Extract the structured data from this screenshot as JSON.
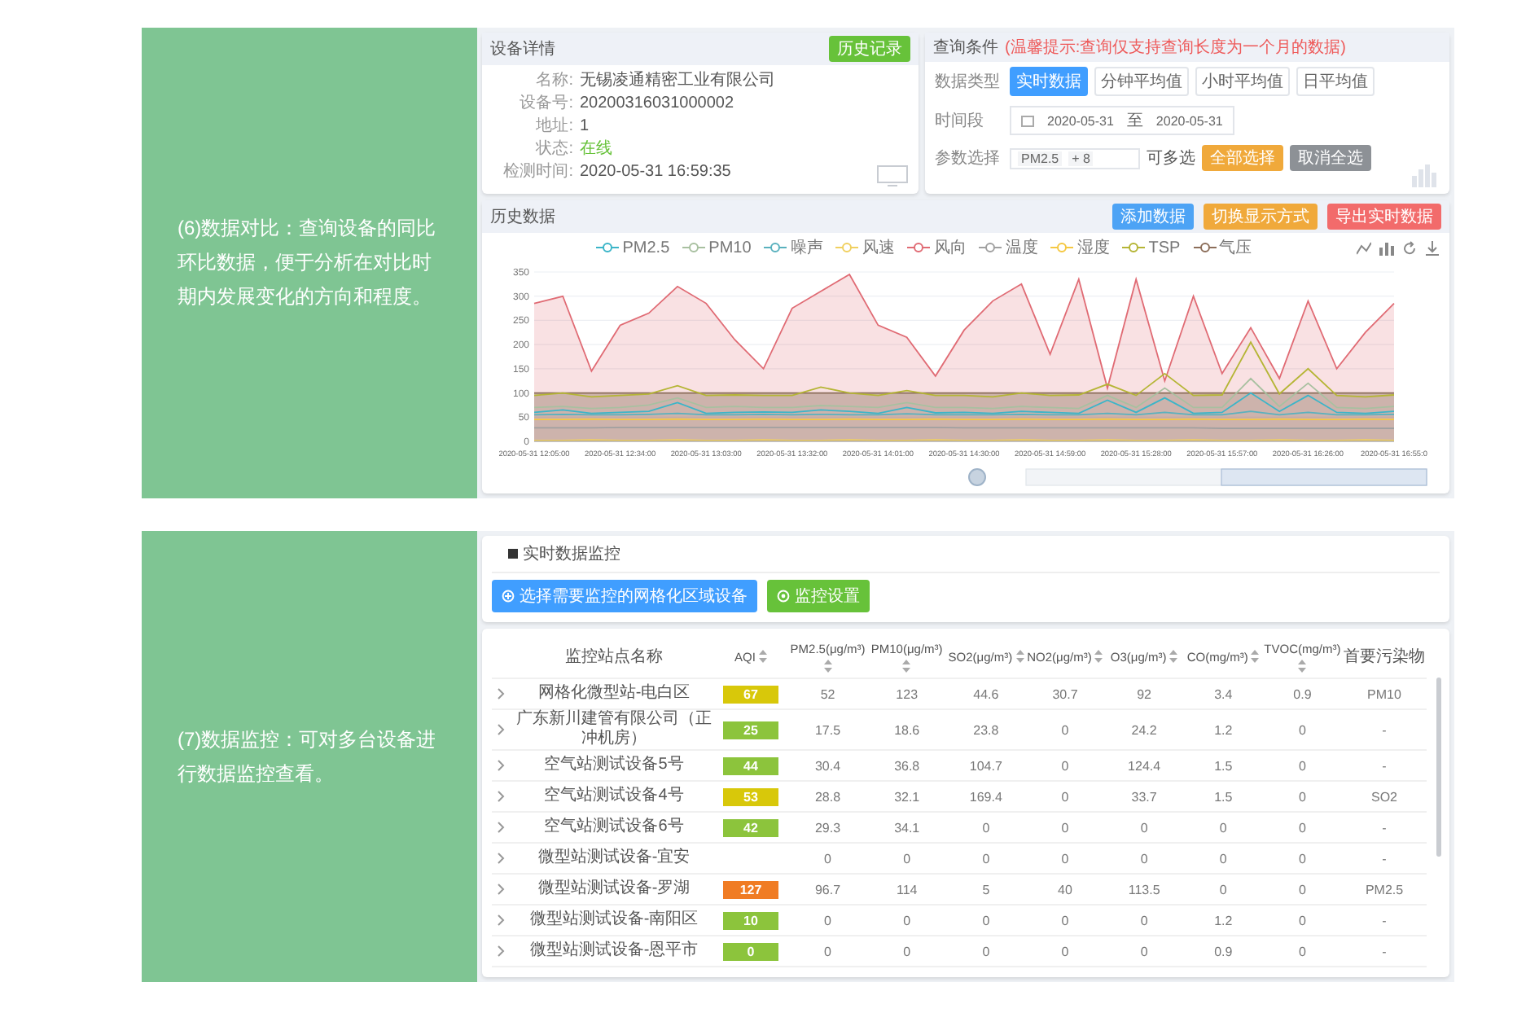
{
  "comparison": {
    "caption": "(6)数据对比：查询设备的同比环比数据，便于分析在对比时期内发展变化的方向和程度。",
    "device_panel": {
      "title": "设备详情",
      "button": "历史记录",
      "fields": [
        {
          "label": "名称:",
          "value": "无锡凌通精密工业有限公司",
          "kind": "text"
        },
        {
          "label": "设备号:",
          "value": "20200316031000002",
          "kind": "text"
        },
        {
          "label": "地址:",
          "value": "1",
          "kind": "text"
        },
        {
          "label": "状态:",
          "value": "在线",
          "kind": "status"
        },
        {
          "label": "检测时间:",
          "value": "2020-05-31 16:59:35",
          "kind": "text"
        }
      ]
    },
    "query_panel": {
      "title": "查询条件",
      "hint": "(温馨提示:查询仅支持查询长度为一个月的数据)",
      "data_type": {
        "label": "数据类型",
        "options": [
          {
            "label": "实时数据",
            "selected": true
          },
          {
            "label": "分钟平均值",
            "selected": false
          },
          {
            "label": "小时平均值",
            "selected": false
          },
          {
            "label": "日平均值",
            "selected": false
          }
        ]
      },
      "time_range": {
        "label": "时间段",
        "start": "2020-05-31",
        "separator": "至",
        "end": "2020-05-31"
      },
      "params": {
        "label": "参数选择",
        "tag": "PM2.5",
        "count": "+ 8",
        "note": "可多选",
        "buttons": [
          {
            "label": "全部选择",
            "color": "#f0a93b"
          },
          {
            "label": "取消全选",
            "color": "#8d9196"
          }
        ]
      }
    },
    "history": {
      "title": "历史数据",
      "buttons": [
        {
          "label": "添加数据",
          "color": "#4da3f5"
        },
        {
          "label": "切换显示方式",
          "color": "#f0a93b"
        },
        {
          "label": "导出实时数据",
          "color": "#f26b6b"
        }
      ],
      "chart_data": {
        "type": "line",
        "categories": [
          "2020-05-31 12:05:00",
          null,
          null,
          "2020-05-31 12:34:00",
          null,
          null,
          "2020-05-31 13:03:00",
          null,
          null,
          "2020-05-31 13:32:00",
          null,
          null,
          "2020-05-31 14:01:00",
          null,
          null,
          "2020-05-31 14:30:00",
          null,
          null,
          "2020-05-31 14:59:00",
          null,
          null,
          "2020-05-31 15:28:00",
          null,
          null,
          "2020-05-31 15:57:00",
          null,
          null,
          "2020-05-31 16:26:00",
          null,
          null,
          "2020-05-31 16:55:0"
        ],
        "ylim": [
          0,
          350
        ],
        "grid": true,
        "yticks": [
          0,
          50,
          100,
          150,
          200,
          250,
          300,
          350
        ],
        "series": [
          {
            "name": "PM2.5",
            "type": "line",
            "color": "#3bb5c8",
            "values": [
              60,
              65,
              58,
              60,
              62,
              80,
              58,
              60,
              61,
              60,
              65,
              62,
              58,
              70,
              59,
              60,
              58,
              62,
              60,
              58,
              85,
              60,
              90,
              58,
              60,
              100,
              62,
              95,
              60,
              58,
              62
            ]
          },
          {
            "name": "PM10",
            "type": "line",
            "color": "#a8c0a0",
            "values": [
              70,
              72,
              68,
              70,
              75,
              90,
              70,
              72,
              70,
              70,
              74,
              72,
              70,
              80,
              70,
              70,
              68,
              72,
              70,
              68,
              95,
              70,
              110,
              70,
              70,
              130,
              72,
              120,
              70,
              68,
              72
            ]
          },
          {
            "name": "噪声",
            "type": "line",
            "color": "#5ab1be",
            "values": [
              55,
              56,
              55,
              55,
              56,
              58,
              55,
              55,
              56,
              55,
              56,
              55,
              55,
              57,
              55,
              55,
              55,
              56,
              55,
              55,
              58,
              55,
              60,
              55,
              55,
              62,
              55,
              60,
              55,
              55,
              56
            ]
          },
          {
            "name": "风速",
            "type": "line",
            "color": "#f0d060",
            "values": [
              2,
              2,
              3,
              2,
              2,
              3,
              2,
              2,
              3,
              2,
              2,
              3,
              2,
              2,
              3,
              2,
              2,
              3,
              2,
              2,
              3,
              2,
              2,
              3,
              2,
              2,
              3,
              2,
              2,
              3,
              2
            ]
          },
          {
            "name": "风向",
            "type": "area",
            "color": "#e06b74",
            "values": [
              285,
              300,
              145,
              240,
              265,
              320,
              285,
              210,
              150,
              275,
              310,
              345,
              240,
              215,
              135,
              230,
              290,
              325,
              180,
              335,
              110,
              335,
              125,
              300,
              140,
              235,
              130,
              290,
              150,
              225,
              285
            ]
          },
          {
            "name": "温度",
            "type": "line",
            "color": "#a0a0a0",
            "values": [
              28,
              28,
              28,
              29,
              29,
              29,
              29,
              29,
              29,
              29,
              29,
              29,
              29,
              29,
              29,
              28,
              28,
              28,
              28,
              28,
              28,
              28,
              28,
              28,
              27,
              27,
              27,
              27,
              27,
              27,
              27
            ]
          },
          {
            "name": "湿度",
            "type": "line",
            "color": "#f5c842",
            "values": [
              45,
              45,
              46,
              45,
              45,
              46,
              45,
              45,
              46,
              45,
              45,
              46,
              45,
              45,
              46,
              45,
              45,
              46,
              45,
              45,
              46,
              45,
              45,
              46,
              45,
              45,
              46,
              45,
              45,
              46,
              45
            ]
          },
          {
            "name": "TSP",
            "type": "line",
            "color": "#b5b535",
            "values": [
              95,
              100,
              92,
              95,
              98,
              115,
              95,
              96,
              95,
              95,
              112,
              100,
              95,
              105,
              95,
              95,
              92,
              100,
              95,
              96,
              118,
              95,
              140,
              95,
              96,
              205,
              98,
              150,
              95,
              92,
              96
            ]
          },
          {
            "name": "气压",
            "type": "area",
            "color": "#8c6e5a",
            "values": [
              100,
              100,
              100,
              100,
              100,
              100,
              100,
              100,
              100,
              100,
              100,
              100,
              100,
              100,
              100,
              100,
              100,
              100,
              100,
              100,
              100,
              100,
              100,
              100,
              100,
              100,
              100,
              100,
              100,
              100,
              100
            ]
          }
        ]
      }
    }
  },
  "monitoring": {
    "caption": "(7)数据监控：可对多台设备进行数据监控查看。",
    "panel": {
      "title": "实时数据监控",
      "buttons": [
        {
          "label": "选择需要监控的网格化区域设备",
          "color": "#409eff"
        },
        {
          "label": "监控设置",
          "color": "#67c23a"
        }
      ]
    },
    "table": {
      "columns": [
        {
          "label": "监控站点名称",
          "sortable": false
        },
        {
          "label": "AQI",
          "sortable": true
        },
        {
          "label": "PM2.5(μg/m³)",
          "sortable": true
        },
        {
          "label": "PM10(μg/m³)",
          "sortable": true
        },
        {
          "label": "SO2(μg/m³)",
          "sortable": true
        },
        {
          "label": "NO2(μg/m³)",
          "sortable": true
        },
        {
          "label": "O3(μg/m³)",
          "sortable": true
        },
        {
          "label": "CO(mg/m³)",
          "sortable": true
        },
        {
          "label": "TVOC(mg/m³)",
          "sortable": true
        },
        {
          "label": "首要污染物",
          "sortable": false
        }
      ],
      "rows": [
        {
          "expanded": false,
          "color": "#d8c80a",
          "cells": [
            "网格化微型站-电白区",
            "67",
            "52",
            "123",
            "44.6",
            "30.7",
            "92",
            "3.4",
            "0.9",
            "PM10"
          ]
        },
        {
          "expanded": false,
          "color": "#8cc43c",
          "cells": [
            "广东新川建管有限公司（正冲机房）",
            "25",
            "17.5",
            "18.6",
            "23.8",
            "0",
            "24.2",
            "1.2",
            "0",
            "-"
          ]
        },
        {
          "expanded": false,
          "color": "#8cc43c",
          "cells": [
            "空气站测试设备5号",
            "44",
            "30.4",
            "36.8",
            "104.7",
            "0",
            "124.4",
            "1.5",
            "0",
            "-"
          ]
        },
        {
          "expanded": false,
          "color": "#d8c80a",
          "cells": [
            "空气站测试设备4号",
            "53",
            "28.8",
            "32.1",
            "169.4",
            "0",
            "33.7",
            "1.5",
            "0",
            "SO2"
          ]
        },
        {
          "expanded": false,
          "color": "#8cc43c",
          "cells": [
            "空气站测试设备6号",
            "42",
            "29.3",
            "34.1",
            "0",
            "0",
            "0",
            "0",
            "0",
            "-"
          ]
        },
        {
          "expanded": false,
          "cells": [
            "微型站测试设备-宜安",
            "",
            "0",
            "0",
            "0",
            "0",
            "0",
            "0",
            "0",
            "-"
          ]
        },
        {
          "expanded": false,
          "color": "#f07c24",
          "cells": [
            "微型站测试设备-罗湖",
            "127",
            "96.7",
            "114",
            "5",
            "40",
            "113.5",
            "0",
            "0",
            "PM2.5"
          ]
        },
        {
          "expanded": false,
          "color": "#8cc43c",
          "cells": [
            "微型站测试设备-南阳区",
            "10",
            "0",
            "0",
            "0",
            "0",
            "0",
            "1.2",
            "0",
            "-"
          ]
        },
        {
          "expanded": false,
          "color": "#8cc43c",
          "cells": [
            "微型站测试设备-恩平市",
            "0",
            "0",
            "0",
            "0",
            "0",
            "0",
            "0.9",
            "0",
            "-"
          ]
        }
      ]
    }
  }
}
